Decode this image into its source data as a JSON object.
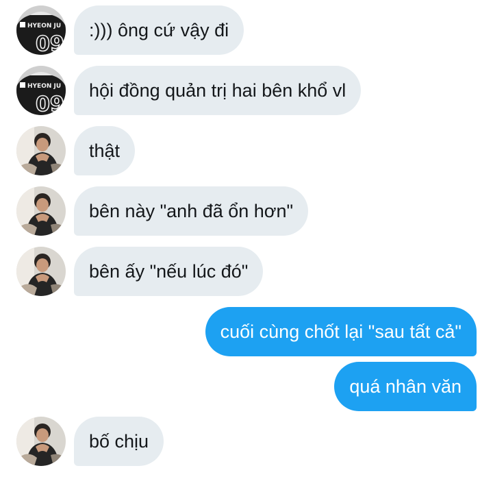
{
  "conversation": {
    "messages": [
      {
        "from": "other",
        "avatar": "avatar-jersey",
        "text": ":))) ông cứ vậy đi"
      },
      {
        "from": "other",
        "avatar": "avatar-jersey",
        "text": "hội đồng quản trị hai bên khổ vl"
      },
      {
        "from": "other",
        "avatar": "avatar-man",
        "text": "thật"
      },
      {
        "from": "other",
        "avatar": "avatar-man",
        "text": "bên này \"anh đã ổn hơn\""
      },
      {
        "from": "other",
        "avatar": "avatar-man",
        "text": "bên ấy \"nếu lúc đó\""
      },
      {
        "from": "me",
        "text": "cuối cùng chốt lại \"sau tất cả\""
      },
      {
        "from": "me",
        "text": "quá nhân văn"
      },
      {
        "from": "other",
        "avatar": "avatar-man",
        "text": "bố chịu"
      }
    ]
  },
  "avatars": {
    "jersey_lettering": "HYEON JU",
    "jersey_number": "09"
  },
  "colors": {
    "incoming_bubble": "#e6ecf0",
    "outgoing_bubble": "#1da1f2",
    "incoming_text": "#14171a",
    "outgoing_text": "#ffffff"
  }
}
